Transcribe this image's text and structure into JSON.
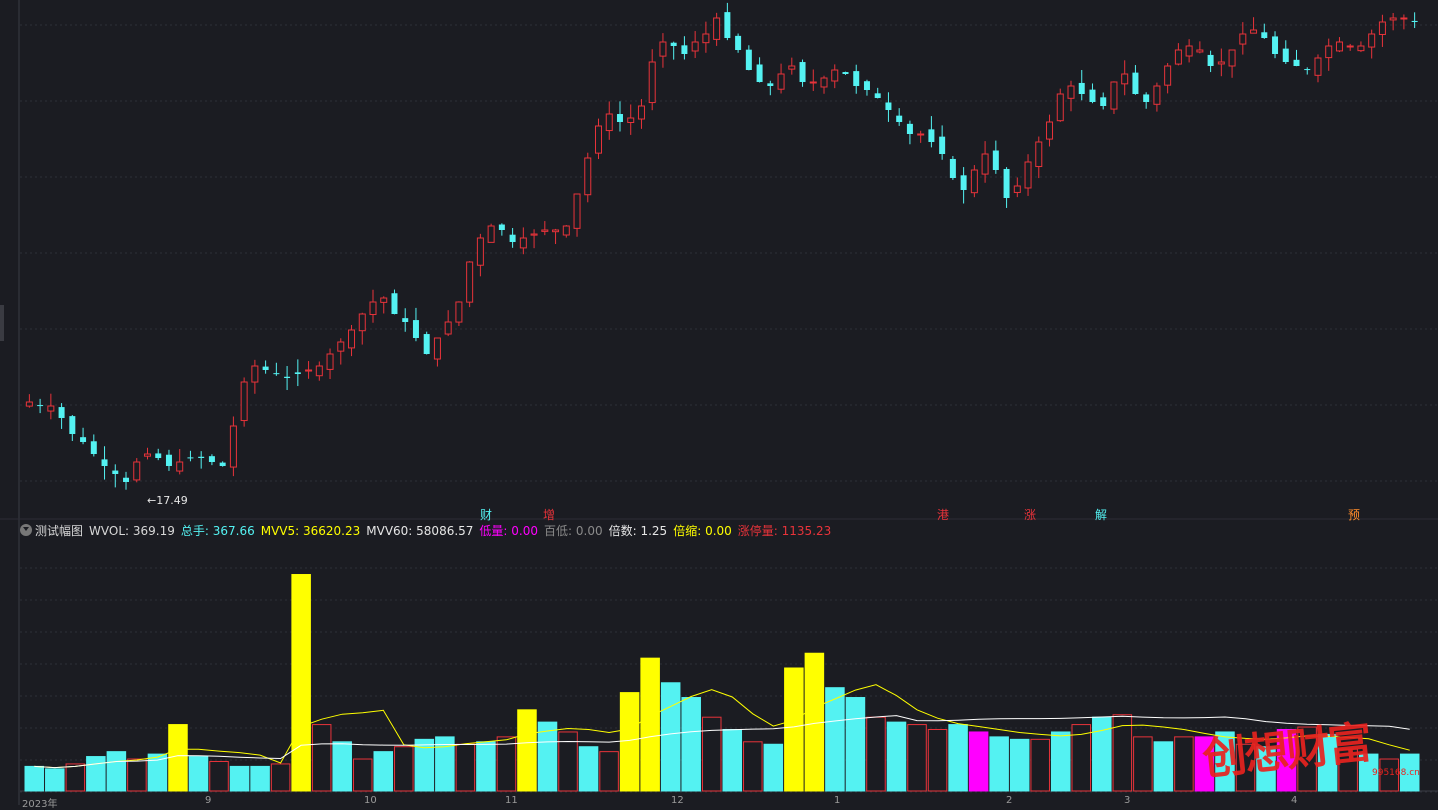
{
  "colors": {
    "background": "#1b1c22",
    "up": "#e8333a",
    "down": "#54f2f2",
    "volume_yellow": "#ffff00",
    "volume_magenta": "#ff00ff",
    "grid": "#2e2f38",
    "ma5": "#ffff00",
    "ma60": "#ffffff"
  },
  "indicator": {
    "name": "测试幅图",
    "wvol_label": "WVOL: 369.19",
    "total_label": "总手:",
    "total_value": "367.66",
    "mvv5": "MVV5: 36620.23",
    "mvv60": "MVV60: 58086.57",
    "low_vol_label": "低量:",
    "low_vol_value": "0.00",
    "baidi_label": "百低:",
    "baidi_value": "0.00",
    "multiple": "倍数: 1.25",
    "shrink_label": "倍缩:",
    "shrink_value": "0.00",
    "limit_label": "涨停量:",
    "limit_value": "1135.23"
  },
  "price_low_label": "←17.49",
  "markers": [
    {
      "text": "财",
      "color": "#54f2f2"
    },
    {
      "text": "增",
      "color": "#e8333a"
    },
    {
      "text": "港",
      "color": "#e8333a"
    },
    {
      "text": "涨",
      "color": "#e8333a"
    },
    {
      "text": "解",
      "color": "#54f2f2"
    },
    {
      "text": "预",
      "color": "#ff8c2a"
    }
  ],
  "x_axis_labels": [
    "2023年",
    "9",
    "10",
    "11",
    "12",
    "1",
    "2",
    "3",
    "4"
  ],
  "watermark": {
    "text": "创想财富",
    "site": "995168.cn"
  },
  "chart_data": {
    "type": "candlestick",
    "price_min_label": "17.49",
    "close_path": [
      0.04,
      0.03,
      0.03,
      0.0,
      -0.04,
      -0.06,
      -0.09,
      -0.12,
      -0.14,
      -0.16,
      -0.11,
      -0.09,
      -0.1,
      -0.12,
      -0.11,
      -0.1,
      -0.1,
      -0.11,
      -0.12,
      -0.02,
      0.09,
      0.13,
      0.12,
      0.11,
      0.1,
      0.11,
      0.12,
      0.13,
      0.16,
      0.19,
      0.22,
      0.26,
      0.29,
      0.3,
      0.26,
      0.24,
      0.2,
      0.16,
      0.2,
      0.24,
      0.29,
      0.39,
      0.45,
      0.48,
      0.47,
      0.44,
      0.45,
      0.46,
      0.47,
      0.47,
      0.48,
      0.56,
      0.65,
      0.73,
      0.76,
      0.74,
      0.75,
      0.78,
      0.89,
      0.94,
      0.93,
      0.91,
      0.94,
      0.96,
      1.0,
      0.95,
      0.92,
      0.87,
      0.84,
      0.83,
      0.86,
      0.88,
      0.84,
      0.84,
      0.85,
      0.87,
      0.86,
      0.83,
      0.82,
      0.8,
      0.77,
      0.74,
      0.71,
      0.71,
      0.69,
      0.66,
      0.6,
      0.57,
      0.62,
      0.66,
      0.62,
      0.55,
      0.58,
      0.64,
      0.69,
      0.74,
      0.81,
      0.83,
      0.81,
      0.79,
      0.78,
      0.84,
      0.86,
      0.81,
      0.79,
      0.83,
      0.88,
      0.92,
      0.93,
      0.92,
      0.88,
      0.89,
      0.92,
      0.96,
      0.97,
      0.95,
      0.91,
      0.89,
      0.88,
      0.87,
      0.9,
      0.93,
      0.94,
      0.93,
      0.93,
      0.96,
      0.99,
      1.0,
      1.0,
      0.99
    ],
    "volume_path": [
      0.1,
      0.09,
      0.11,
      0.14,
      0.16,
      0.13,
      0.15,
      0.27,
      0.14,
      0.12,
      0.1,
      0.1,
      0.11,
      0.88,
      0.27,
      0.2,
      0.13,
      0.16,
      0.18,
      0.21,
      0.22,
      0.19,
      0.2,
      0.22,
      0.33,
      0.28,
      0.24,
      0.18,
      0.16,
      0.4,
      0.54,
      0.44,
      0.38,
      0.3,
      0.25,
      0.2,
      0.19,
      0.5,
      0.56,
      0.42,
      0.38,
      0.3,
      0.28,
      0.27,
      0.25,
      0.27,
      0.24,
      0.22,
      0.21,
      0.21,
      0.24,
      0.27,
      0.3,
      0.31,
      0.22,
      0.2,
      0.22,
      0.22,
      0.24,
      0.19,
      0.18,
      0.25,
      0.26,
      0.23,
      0.17,
      0.15,
      0.13,
      0.15
    ]
  }
}
